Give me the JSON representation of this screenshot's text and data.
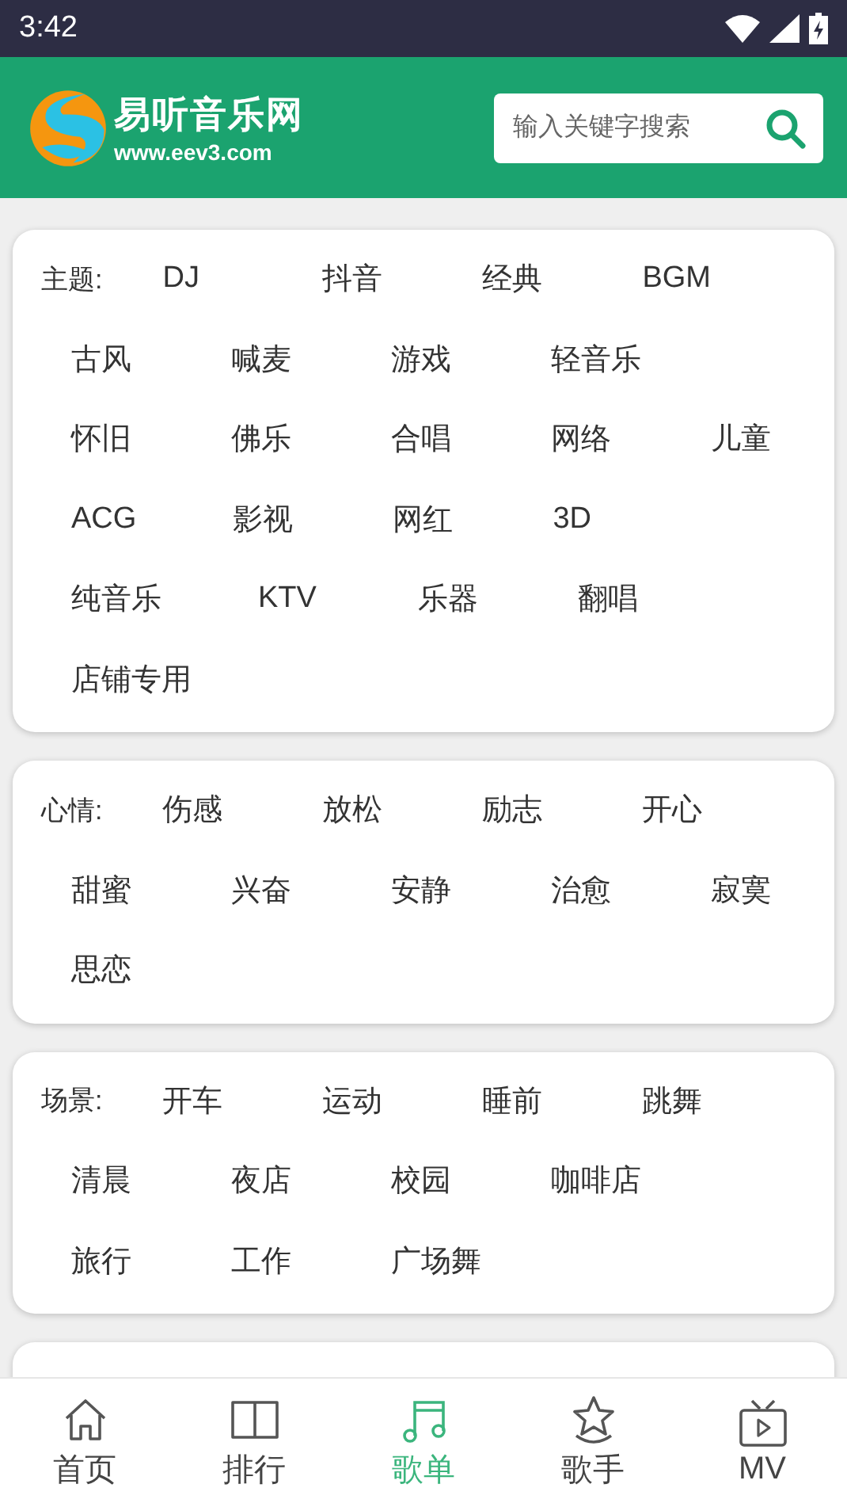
{
  "status_bar": {
    "time": "3:42"
  },
  "header": {
    "site_name": "易听音乐网",
    "site_url": "www.eev3.com",
    "search": {
      "placeholder": "输入关键字搜索"
    }
  },
  "categories": [
    {
      "label": "主题:",
      "rows": [
        [
          "DJ",
          "抖音",
          "经典",
          "BGM"
        ],
        [
          "古风",
          "喊麦",
          "游戏",
          "轻音乐"
        ],
        [
          "怀旧",
          "佛乐",
          "合唱",
          "网络",
          "儿童"
        ],
        [
          "ACG",
          "影视",
          "网红",
          "3D"
        ],
        [
          "纯音乐",
          "KTV",
          "乐器",
          "翻唱"
        ],
        [
          "店铺专用"
        ]
      ]
    },
    {
      "label": "心情:",
      "rows": [
        [
          "伤感",
          "放松",
          "励志",
          "开心"
        ],
        [
          "甜蜜",
          "兴奋",
          "安静",
          "治愈",
          "寂寞"
        ],
        [
          "思恋"
        ]
      ]
    },
    {
      "label": "场景:",
      "rows": [
        [
          "开车",
          "运动",
          "睡前",
          "跳舞"
        ],
        [
          "清晨",
          "夜店",
          "校园",
          "咖啡店"
        ],
        [
          "旅行",
          "工作",
          "广场舞"
        ]
      ]
    }
  ],
  "bottom_nav": [
    {
      "kind": "home",
      "label": "首页",
      "selected": false
    },
    {
      "kind": "book",
      "label": "排行",
      "selected": false
    },
    {
      "kind": "music",
      "label": "歌单",
      "selected": true
    },
    {
      "kind": "star",
      "label": "歌手",
      "selected": false
    },
    {
      "kind": "tv",
      "label": "MV",
      "selected": false
    }
  ]
}
